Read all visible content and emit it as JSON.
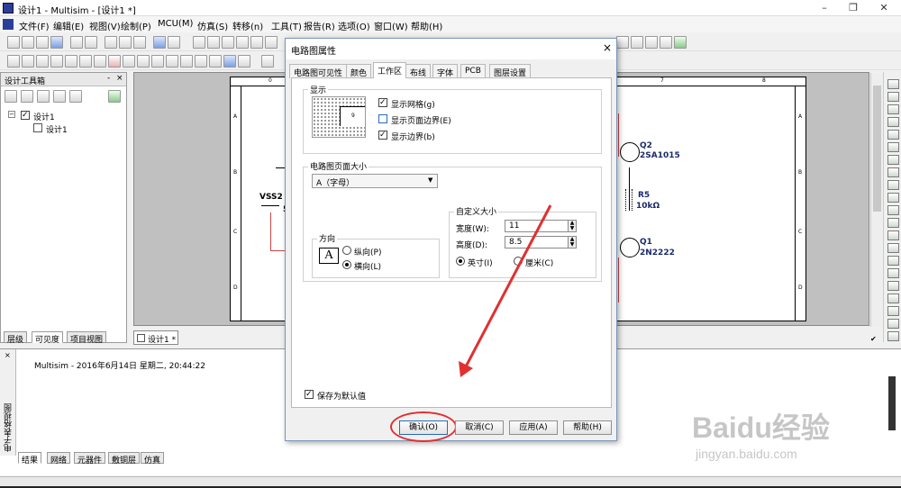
{
  "window": {
    "title": "设计1 - Multisim - [设计1 *]"
  },
  "menu": [
    "文件(F)",
    "编辑(E)",
    "视图(V)",
    "绘制(P)",
    "MCU(M)",
    "仿真(S)",
    "转移(n)",
    "工具(T)",
    "报告(R)",
    "选项(O)",
    "窗口(W)",
    "帮助(H)"
  ],
  "toolbox": {
    "title": "设计工具箱",
    "tree_root": "设计1",
    "tree_child": "设计1",
    "tabs": [
      "层级",
      "可见度",
      "项目视图"
    ]
  },
  "doc_tab": "设计1 *",
  "schematic": {
    "labels": [
      "Q2",
      "2SA1015",
      "R5",
      "10kΩ",
      "Q1",
      "2N2222",
      "VSS2",
      "5"
    ],
    "ruler_top": [
      "0",
      "7",
      "8"
    ],
    "ruler_side": [
      "A",
      "B",
      "C",
      "D"
    ]
  },
  "output": {
    "log_line": "Multisim  -  2016年6月14日 星期二, 20:44:22",
    "side_label": "电子表格视图",
    "tabs": [
      "结果",
      "网络",
      "元器件",
      "敷铜层",
      "仿真"
    ]
  },
  "dialog": {
    "title": "电路图属性",
    "close": "×",
    "tabs": [
      "电路图可见性",
      "颜色",
      "工作区",
      "布线",
      "字体",
      "PCB",
      "图层设置"
    ],
    "display_group": "显示",
    "show_grid": "显示网格(g)",
    "show_page_bounds": "显示页面边界(E)",
    "show_border": "显示边界(b)",
    "sheet_size_group": "电路图页面大小",
    "sheet_size_value": "A（字母）",
    "orientation_group": "方向",
    "portrait": "纵向(P)",
    "landscape": "横向(L)",
    "custom_group": "自定义大小",
    "width_label": "宽度(W):",
    "width_value": "11",
    "height_label": "高度(D):",
    "height_value": "8.5",
    "inch": "英寸(I)",
    "cm": "厘米(C)",
    "save_default": "保存为默认值",
    "buttons": {
      "ok": "确认(O)",
      "cancel": "取消(C)",
      "apply": "应用(A)",
      "help": "帮助(H)"
    }
  },
  "watermark": {
    "brand": "Baidu经验",
    "url": "jingyan.baidu.com"
  },
  "colors": {
    "annotation_red": "#e03030",
    "schematic_blue": "#1a2a6c"
  }
}
